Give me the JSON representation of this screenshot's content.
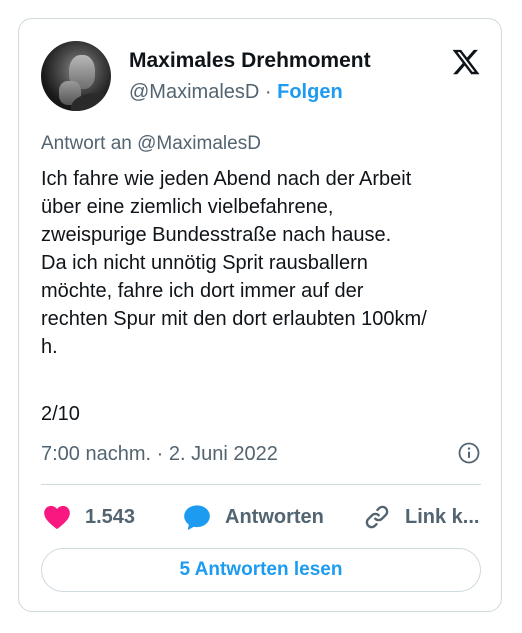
{
  "author": {
    "name": "Maximales Drehmoment",
    "handle": "@MaximalesD",
    "separator": "·",
    "follow_label": "Folgen"
  },
  "tweet": {
    "reply_to": "Antwort an @MaximalesD",
    "text": "Ich fahre wie jeden Abend nach der Arbeit\nüber eine ziemlich vielbefahrene,\nzweispurige Bundesstraße nach hause.\nDa ich nicht unnötig Sprit rausballern\nmöchte, fahre ich dort immer auf der\nrechten Spur mit den dort erlaubten 100km/\nh.",
    "counter": "2/10",
    "timestamp": "7:00 nachm. · 2. Juni 2022"
  },
  "actions": {
    "likes_count": "1.543",
    "reply_label": "Antworten",
    "link_label": "Link k..."
  },
  "read_replies_label": "5 Antworten lesen",
  "icons": {
    "logo": "x-logo-icon",
    "info": "info-icon",
    "like": "heart-icon",
    "reply": "speech-bubble-icon",
    "link": "link-icon"
  },
  "colors": {
    "accent": "#1d9bf0",
    "like": "#f91880",
    "secondary_text": "#536471",
    "border": "#cfd9de"
  }
}
